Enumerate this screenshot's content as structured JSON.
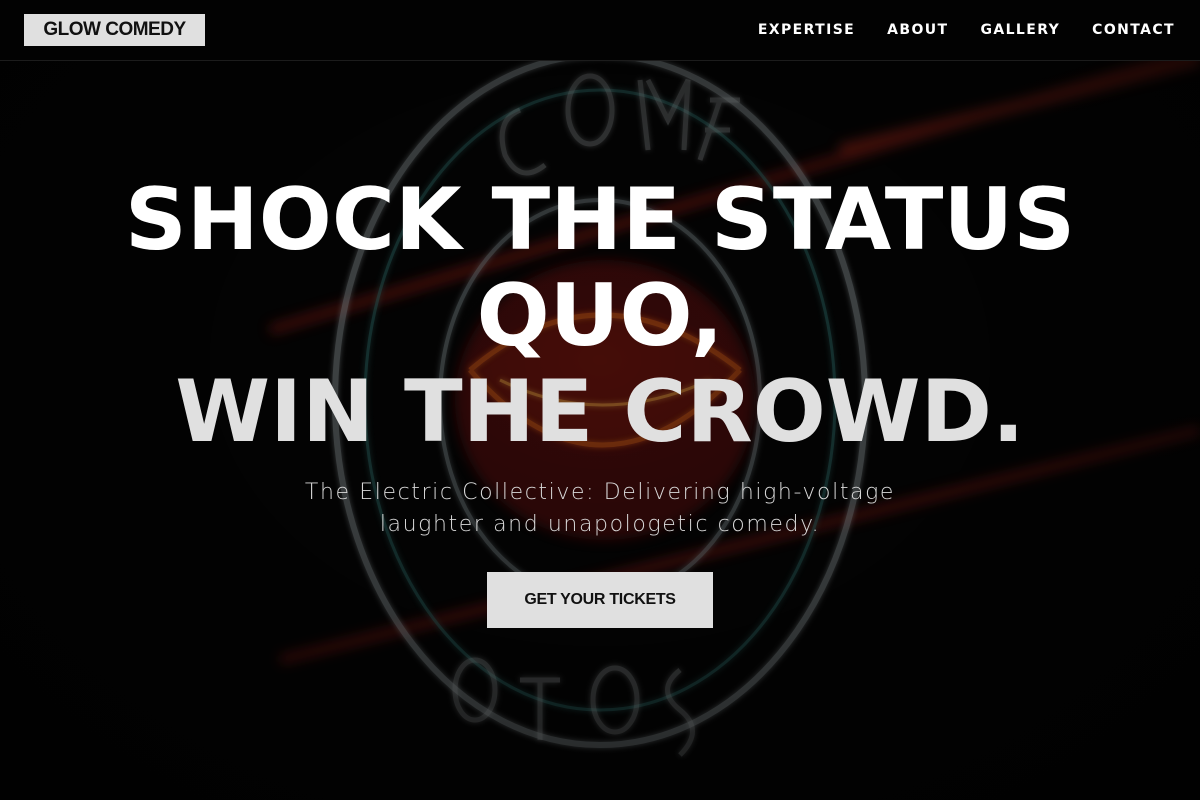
{
  "header": {
    "logo": "GLOW COMEDY",
    "nav": [
      {
        "label": "EXPERTISE"
      },
      {
        "label": "ABOUT"
      },
      {
        "label": "GALLERY"
      },
      {
        "label": "CONTACT"
      }
    ]
  },
  "hero": {
    "headline_line1": "SHOCK THE STATUS QUO,",
    "headline_line2": "WIN THE CROWD.",
    "subtitle": "The Electric Collective: Delivering high-voltage laughter and unapologetic comedy.",
    "cta_label": "GET YOUR TICKETS"
  },
  "background": {
    "image": "neon-comedy-store-sign",
    "colors": {
      "page": "#050505",
      "neon_white": "#cfd8dc",
      "neon_red": "#c0281e",
      "neon_orange": "#e07020",
      "accent_button": "#e0e0e0"
    }
  }
}
